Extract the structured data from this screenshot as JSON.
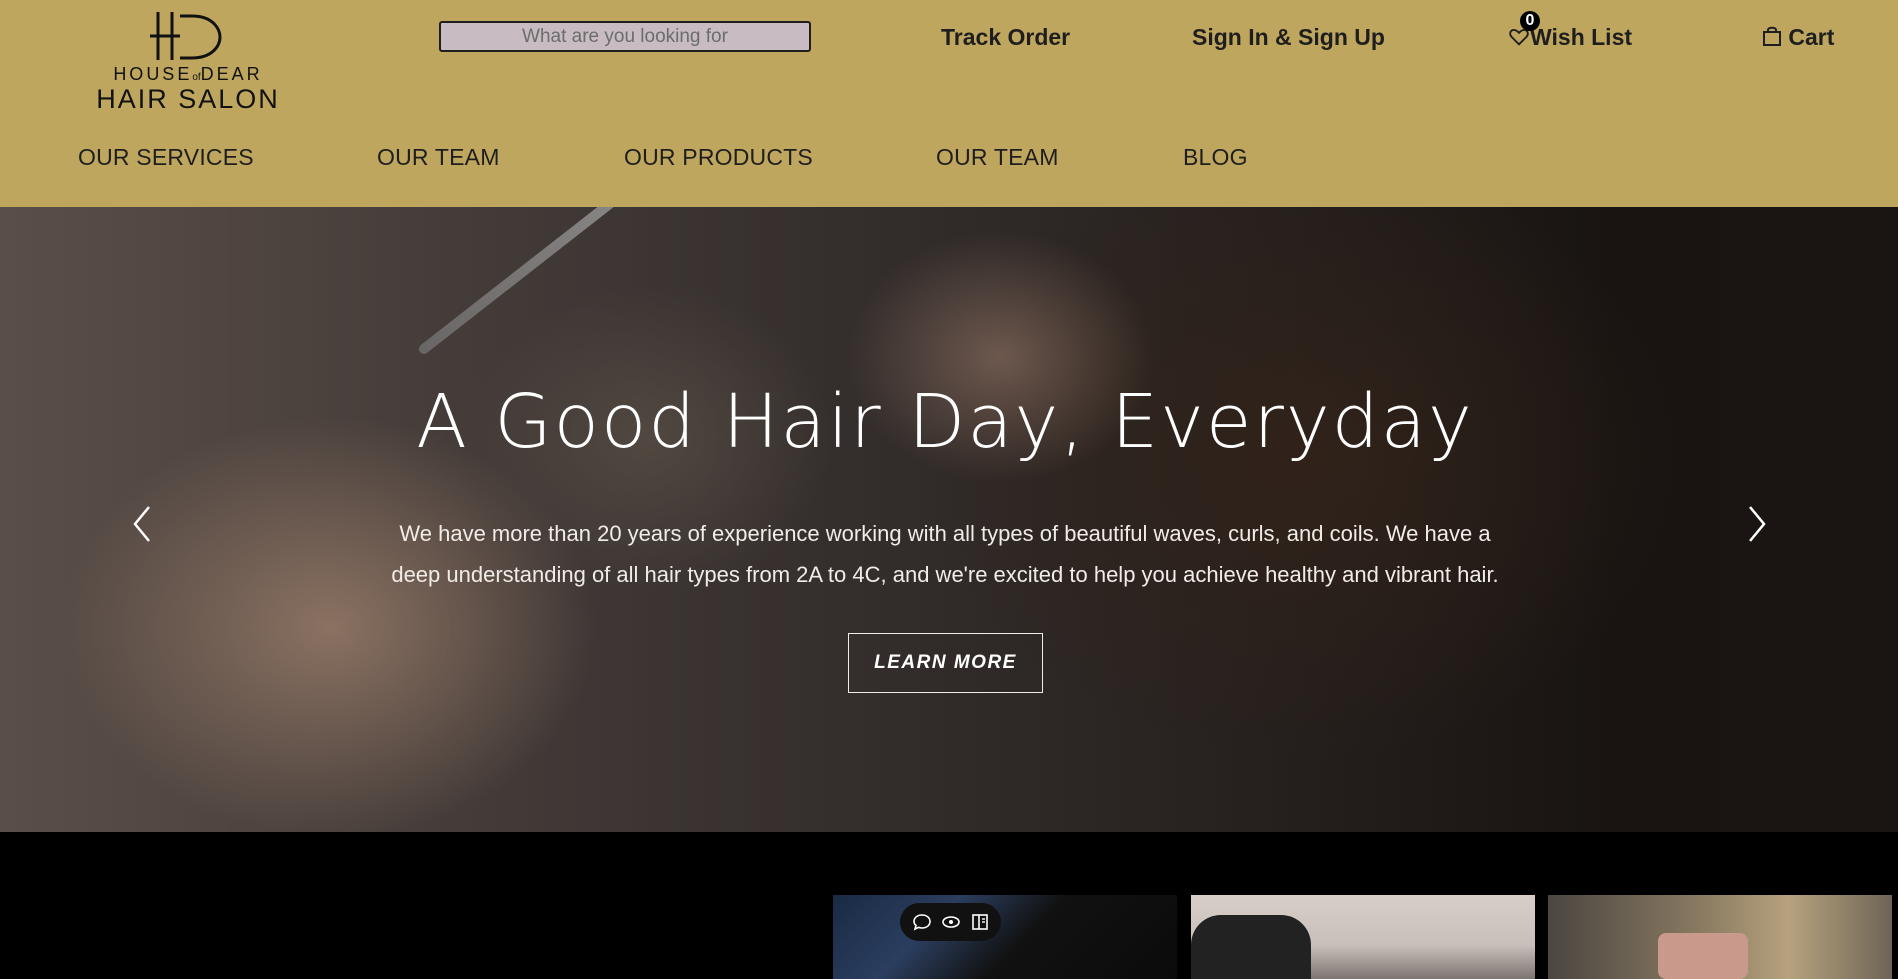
{
  "brand": {
    "small_left": "HOUSE",
    "small_of": "of",
    "small_right": "DEAR",
    "name": "HAIR SALON"
  },
  "search": {
    "placeholder": "What are you looking for"
  },
  "header_links": {
    "track_order": "Track Order",
    "sign_in": "Sign In & Sign Up",
    "wish_list": "Wish List",
    "wish_count": "0",
    "cart": "Cart"
  },
  "nav": [
    "OUR SERVICES",
    "OUR TEAM",
    "OUR PRODUCTS",
    "OUR TEAM",
    "BLOG"
  ],
  "hero": {
    "title": "A Good Hair Day, Everyday",
    "text": "We have more than 20 years of experience working with all types of beautiful waves, curls, and coils. We have a deep understanding of all hair types from 2A to 4C, and we're excited to help you achieve healthy and vibrant hair.",
    "button": "LEARN MORE"
  },
  "colors": {
    "header_bg": "#bfa65f",
    "text_dark": "#1e1e1e",
    "page_bg": "#000000"
  },
  "icons": [
    "heart-icon",
    "bag-icon",
    "chevron-left-icon",
    "chevron-right-icon",
    "comment-icon",
    "eye-icon",
    "panel-icon"
  ]
}
